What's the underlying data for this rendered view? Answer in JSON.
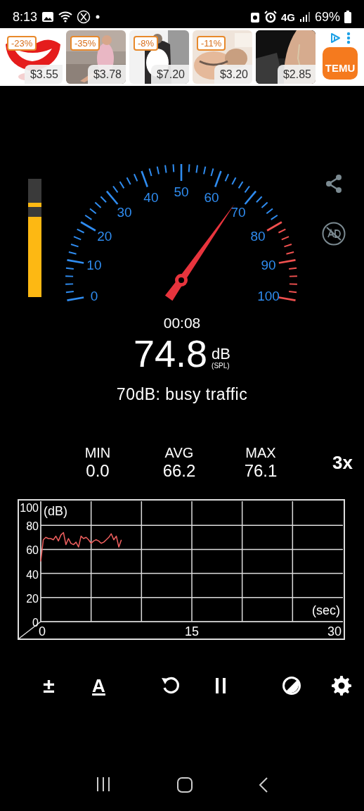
{
  "status_bar": {
    "time": "8:13",
    "network": "4G",
    "battery": "69%"
  },
  "ad_banner": {
    "products": [
      {
        "discount": "-23%",
        "price": "$3.55"
      },
      {
        "discount": "-35%",
        "price": "$3.78"
      },
      {
        "discount": "-8%",
        "price": "$7.20"
      },
      {
        "discount": "-11%",
        "price": "$3.20"
      },
      {
        "price": "$2.85"
      }
    ],
    "logo": "TEMU"
  },
  "meter": {
    "level": 0.68,
    "peak": {
      "level": 0.76
    }
  },
  "gauge": {
    "scale": [
      {
        "label": "0",
        "kind": "normal"
      },
      {
        "label": "10",
        "kind": "normal"
      },
      {
        "label": "20",
        "kind": "normal"
      },
      {
        "label": "30",
        "kind": "normal"
      },
      {
        "label": "40",
        "kind": "normal"
      },
      {
        "label": "50",
        "kind": "normal"
      },
      {
        "label": "60",
        "kind": "normal"
      },
      {
        "label": "70",
        "kind": "normal"
      },
      {
        "label": "80",
        "kind": "alert"
      },
      {
        "label": "90",
        "kind": "alert"
      },
      {
        "label": "100",
        "kind": "alert"
      }
    ]
  },
  "readout": {
    "elapsed": "00:08",
    "value": "74.8",
    "unit": "dB",
    "weighting": "(SPL)",
    "description": "70dB: busy traffic"
  },
  "stats": [
    {
      "label": "MIN",
      "value": "0.0"
    },
    {
      "label": "AVG",
      "value": "66.2"
    },
    {
      "label": "MAX",
      "value": "76.1"
    }
  ],
  "zoom_button": "3x",
  "history": {
    "chart_data": {
      "type": "line",
      "xlabel": "(sec)",
      "ylabel": "(dB)",
      "grid": true,
      "xlim": [
        0,
        30
      ],
      "ylim": [
        0,
        100
      ],
      "xticks": [
        0,
        15,
        30
      ],
      "yticks": [
        0,
        20,
        40,
        60,
        80,
        100
      ],
      "x": [
        0,
        0.25,
        0.5,
        0.75,
        1,
        1.25,
        1.5,
        1.75,
        2,
        2.25,
        2.5,
        2.75,
        3,
        3.25,
        3.5,
        3.75,
        4,
        4.25,
        4.5,
        4.75,
        5,
        5.25,
        5.5,
        5.75,
        6,
        6.25,
        6.5,
        6.75,
        7,
        7.25,
        7.5,
        7.75,
        8
      ],
      "series": [
        {
          "color": "#f0605f",
          "values": [
            50,
            68,
            70,
            69,
            69,
            68,
            71,
            67,
            72,
            74,
            64,
            69,
            65,
            64,
            66,
            62,
            71,
            69,
            70,
            68,
            65,
            67,
            68,
            67,
            65,
            66,
            68,
            70,
            73,
            68,
            71,
            62,
            68
          ]
        }
      ]
    }
  },
  "toolbar": [
    {
      "kind": "symbol",
      "text": "±",
      "underlined": false
    },
    {
      "kind": "symbol",
      "text": "A",
      "underlined": true
    },
    {
      "kind": "reset"
    },
    {
      "kind": "pause"
    },
    {
      "kind": "contrast"
    },
    {
      "kind": "settings"
    }
  ]
}
